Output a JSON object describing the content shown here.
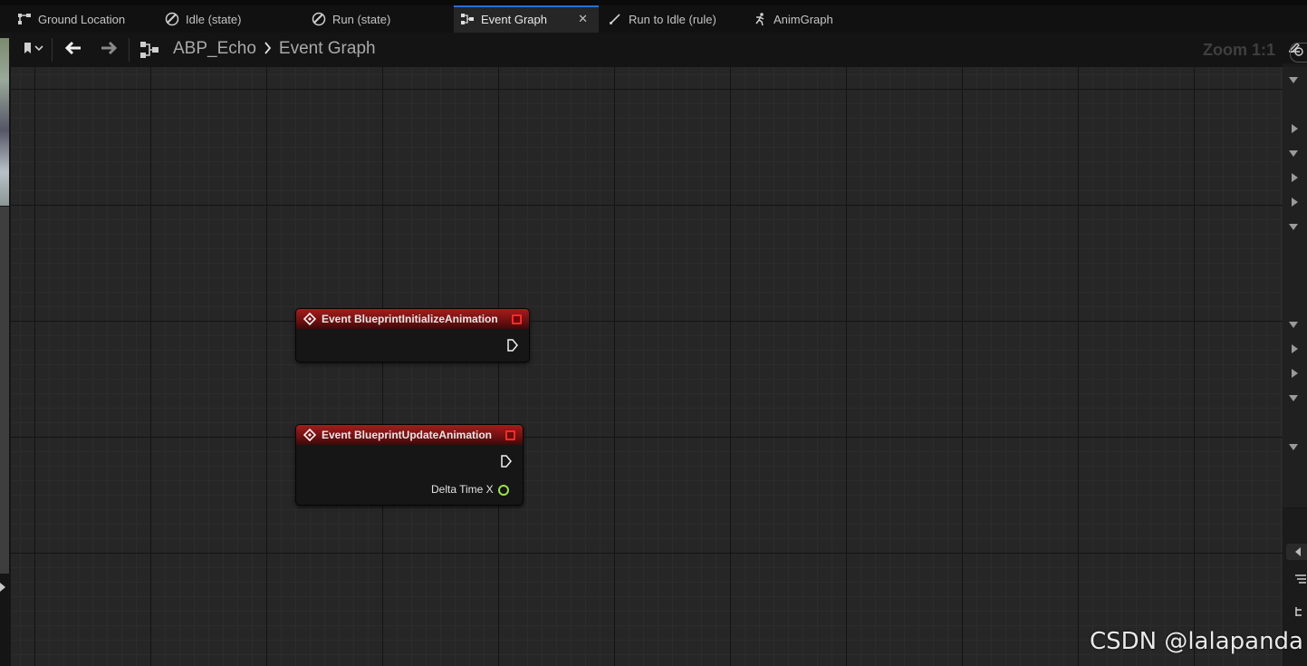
{
  "tabs": [
    {
      "label": "Ground Location",
      "icon": "graph-icon"
    },
    {
      "label": "Idle (state)",
      "icon": "state-icon"
    },
    {
      "label": "Run (state)",
      "icon": "state-icon"
    },
    {
      "label": "Event Graph",
      "icon": "event-graph-icon",
      "active": true
    },
    {
      "label": "Run to Idle (rule)",
      "icon": "transition-rule-icon"
    },
    {
      "label": "AnimGraph",
      "icon": "anim-graph-icon"
    }
  ],
  "toolbar": {
    "breadcrumb_root": "ABP_Echo",
    "breadcrumb_current": "Event Graph",
    "zoom": "Zoom 1:1"
  },
  "nodes": [
    {
      "title": "Event BlueprintInitializeAnimation"
    },
    {
      "title": "Event BlueprintUpdateAnimation",
      "output_label": "Delta Time X"
    }
  ],
  "colors": {
    "event_header": "#a51c1c",
    "active_tab_accent": "#2a6fd6",
    "float_pin": "#9be34a",
    "delegate_pin": "#ff2a2a"
  },
  "watermark": "CSDN @lalapanda"
}
